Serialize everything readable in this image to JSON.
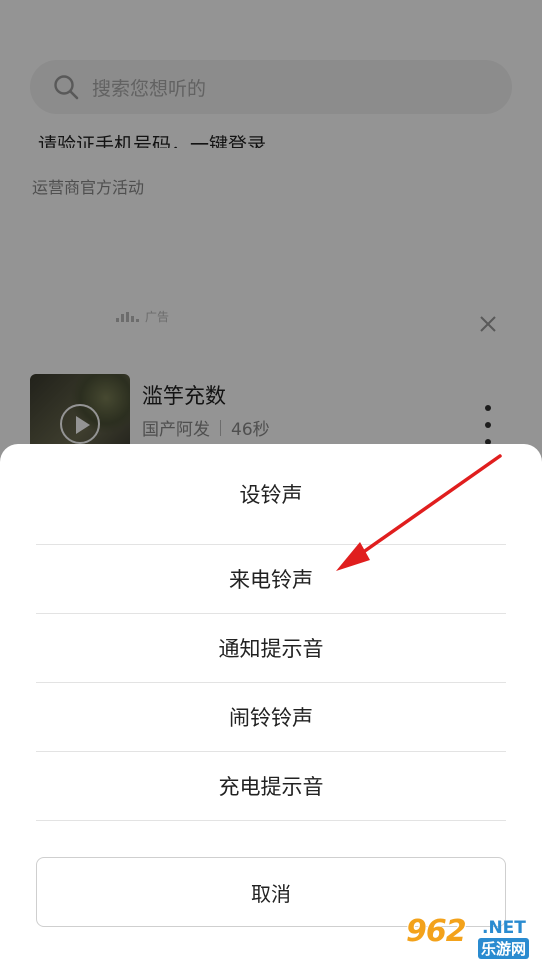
{
  "search": {
    "placeholder": "搜索您想听的"
  },
  "promo": {
    "title": "请验证手机号码，一键登录",
    "subtitle": "运营商官方活动"
  },
  "ad": {
    "label": "广告"
  },
  "song": {
    "title": "滥竽充数",
    "genre": "国产阿发",
    "duration": "46秒"
  },
  "sheet": {
    "title": "设铃声",
    "options": [
      "来电铃声",
      "通知提示音",
      "闹铃铃声",
      "充电提示音"
    ],
    "cancel": "取消"
  },
  "watermark": {
    "number": "962",
    "suffix": ".NET",
    "site": "乐游网"
  },
  "colors": {
    "arrow": "#e01e1e",
    "overlay": "rgba(0,0,0,0.42)",
    "watermark_orange": "#f3a21b",
    "watermark_blue": "#2a8bd0"
  }
}
